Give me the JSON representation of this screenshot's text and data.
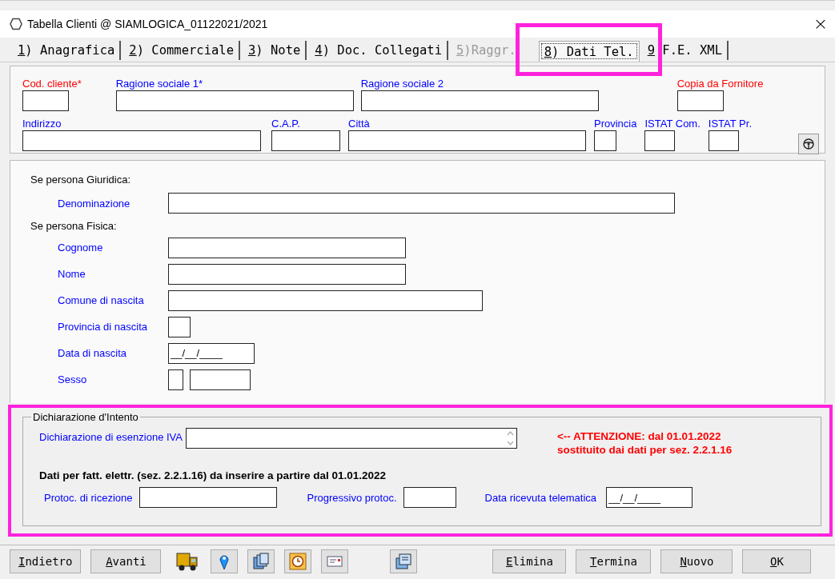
{
  "window": {
    "title": "Tabella Clienti @ SIAMLOGICA_01122021/2021",
    "close": "×"
  },
  "tabs_highlight": true,
  "tabs": [
    {
      "accel": "1",
      "label": ") Anagrafica",
      "selected": false,
      "disabled": false
    },
    {
      "accel": "2",
      "label": ") Commerciale",
      "selected": false,
      "disabled": false
    },
    {
      "accel": "3",
      "label": ") Note",
      "selected": false,
      "disabled": false
    },
    {
      "accel": "4",
      "label": ") Doc. Collegati",
      "selected": false,
      "disabled": false
    },
    {
      "accel": "5",
      "label": ")Raggr.",
      "selected": false,
      "disabled": true
    },
    {
      "accel": "8",
      "label": ") Dati Tel.",
      "selected": true,
      "disabled": false
    },
    {
      "accel": "9",
      "label": " F.E. XML",
      "selected": false,
      "disabled": false
    }
  ],
  "header": {
    "upper_fields": [
      {
        "label": "Cod. cliente*",
        "color": "#ff0000"
      },
      {
        "label": "Ragione sociale 1*",
        "color": "#0000ff"
      },
      {
        "label": "Ragione sociale 2",
        "color": "#0000ff"
      },
      {
        "label": "Copia da Fornitore",
        "color": "#ff0000"
      }
    ],
    "lower_fields": [
      {
        "label": "Indirizzo",
        "color": "#0000ff"
      },
      {
        "label": "C.A.P.",
        "color": "#0000ff"
      },
      {
        "label": "Città",
        "color": "#0000ff"
      },
      {
        "label": "Provincia",
        "color": "#0000ff"
      },
      {
        "label": "ISTAT Com.",
        "color": "#0000ff"
      },
      {
        "label": "ISTAT Pr.",
        "color": "#0000ff"
      }
    ]
  },
  "persona": [
    {
      "heading": "Se persona Giuridica:",
      "fields": [
        {
          "label": "Denominazione",
          "inputs": [
            {
              "kind": "text"
            }
          ]
        }
      ]
    },
    {
      "heading": "Se persona Fisica:",
      "fields": [
        {
          "label": "Cognome",
          "inputs": [
            {
              "kind": "text"
            }
          ]
        },
        {
          "label": "Nome",
          "inputs": [
            {
              "kind": "text"
            }
          ]
        },
        {
          "label": "Comune di nascita",
          "inputs": [
            {
              "kind": "text"
            }
          ]
        },
        {
          "label": "Provincia di nascita",
          "inputs": [
            {
              "kind": "text"
            }
          ]
        },
        {
          "label": "Data di nascita",
          "inputs": [
            {
              "kind": "date",
              "value": "__/__/____"
            }
          ]
        },
        {
          "label": "Sesso",
          "inputs": [
            {
              "kind": "text"
            },
            {
              "kind": "text"
            }
          ]
        }
      ]
    }
  ],
  "dichiarazione": {
    "highlight": true,
    "legend": "Dichiarazione d'Intento",
    "esenzione": {
      "label": "Dichiarazione di esenzione IVA"
    },
    "warning": [
      "<-- ATTENZIONE: dal 01.01.2022",
      "sostituito dai dati per sez. 2.2.1.16"
    ],
    "heading": "Dati per fatt. elettr. (sez. 2.2.1.16) da inserire a partire dal 01.01.2022",
    "fields": [
      {
        "label": "Protoc. di ricezione",
        "kind": "text"
      },
      {
        "label": "Progressivo protoc.",
        "kind": "text"
      },
      {
        "label": "Data ricevuta telematica",
        "kind": "date",
        "value": "__/__/____"
      }
    ]
  },
  "toolbar": [
    {
      "kind": "button",
      "accel": "I",
      "label": "ndietro"
    },
    {
      "kind": "button",
      "accel": "A",
      "label": "vanti"
    },
    {
      "kind": "icon"
    },
    {
      "kind": "icon"
    },
    {
      "kind": "icon"
    },
    {
      "kind": "icon"
    },
    {
      "kind": "icon"
    },
    {
      "kind": "icon"
    },
    {
      "kind": "button",
      "accel": "E",
      "label": "limina"
    },
    {
      "kind": "button",
      "accel": "T",
      "label": "ermina"
    },
    {
      "kind": "button",
      "accel": "N",
      "label": "uovo"
    },
    {
      "kind": "button",
      "accel": "O",
      "label": "K"
    }
  ]
}
